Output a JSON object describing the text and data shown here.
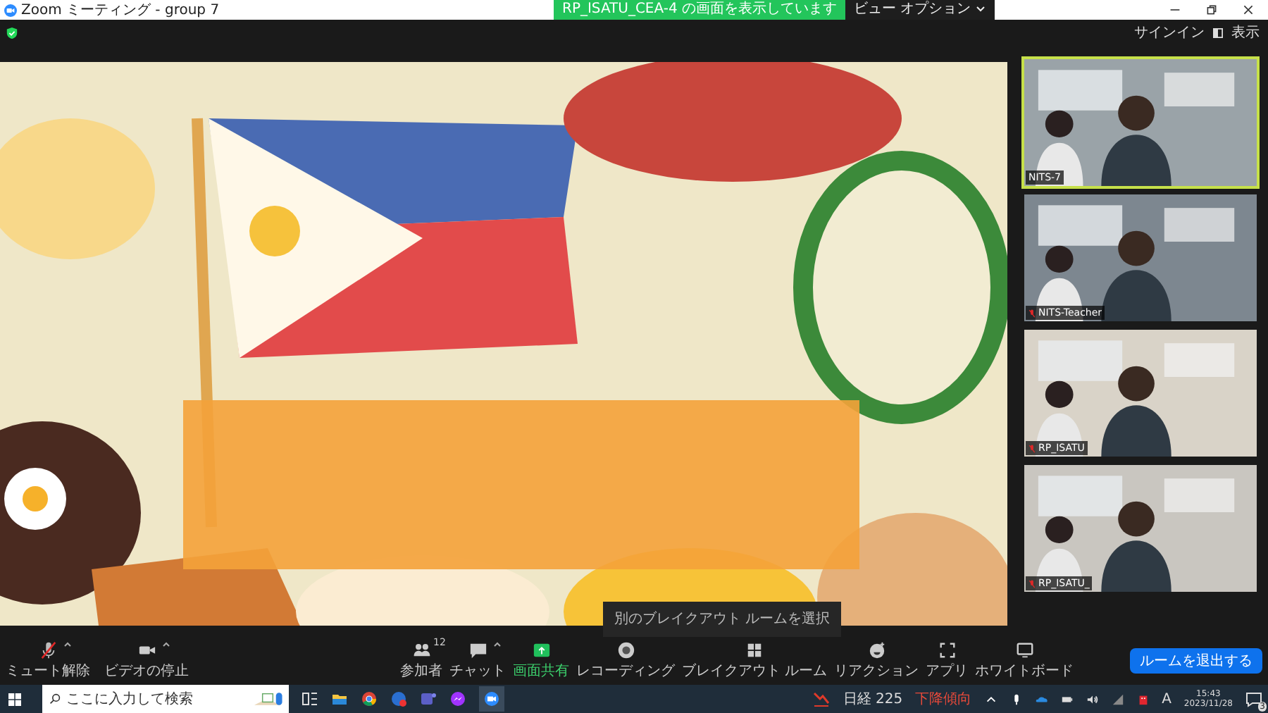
{
  "window": {
    "title": "Zoom ミーティング - group 7"
  },
  "share_banner": {
    "text": "RP_ISATU_CEA-4 の画面を表示しています",
    "view_options": "ビュー オプション"
  },
  "top_bar": {
    "sign_in": "サインイン",
    "view": "表示"
  },
  "videos": [
    {
      "name": "NITS-7",
      "muted": false,
      "speaking": true
    },
    {
      "name": "NITS-Teacher",
      "muted": true,
      "speaking": false
    },
    {
      "name": "RP_ISATU",
      "muted": true,
      "speaking": false
    },
    {
      "name": "RP_ISATU_",
      "muted": true,
      "speaking": false
    }
  ],
  "tooltip": "別のブレイクアウト ルームを選択",
  "toolbar": {
    "left": [
      {
        "label": "ミュート解除",
        "caret": true
      },
      {
        "label": "ビデオの停止",
        "caret": true
      }
    ],
    "center": [
      {
        "label": "参加者",
        "badge": "12",
        "caret": false,
        "active": false
      },
      {
        "label": "チャット",
        "caret": true,
        "active": false
      },
      {
        "label": "画面共有",
        "caret": false,
        "active": true
      },
      {
        "label": "レコーディング",
        "caret": false,
        "active": false
      },
      {
        "label": "ブレイクアウト ルーム",
        "caret": false,
        "active": false
      },
      {
        "label": "リアクション",
        "caret": false,
        "active": false
      },
      {
        "label": "アプリ",
        "caret": false,
        "active": false
      },
      {
        "label": "ホワイトボード",
        "caret": false,
        "active": false
      }
    ],
    "leave": "ルームを退出する"
  },
  "taskbar": {
    "search_placeholder": "ここに入力して検索",
    "stock_name": "日経 225",
    "stock_trend": "下降傾向",
    "ime": "A",
    "time": "15:43",
    "date": "2023/11/28",
    "notifications": "3"
  }
}
